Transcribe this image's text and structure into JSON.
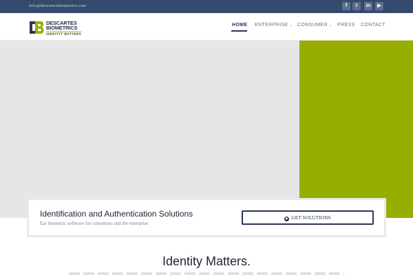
{
  "topbar": {
    "email": "info@descartesbiometrics.com",
    "social": [
      {
        "icon": "facebook-icon",
        "glyph": "f"
      },
      {
        "icon": "twitter-icon",
        "glyph": "t"
      },
      {
        "icon": "linkedin-icon",
        "glyph": "in"
      },
      {
        "icon": "youtube-icon",
        "glyph": "▶"
      }
    ]
  },
  "logo": {
    "line1": "DESCARTES",
    "line2": "BIOMETRICS",
    "tagline": "IDENTITY MATTERS"
  },
  "nav": [
    {
      "label": "HOME",
      "active": true
    },
    {
      "label": "ENTERPRISE",
      "caret": "⌄"
    },
    {
      "label": "CONSUMER",
      "caret": "⌄"
    },
    {
      "label": "PRESS"
    },
    {
      "label": "CONTACT"
    }
  ],
  "solutions": {
    "title": "Identification and Authentication Solutions",
    "subtitle": "Ear biometric software for consumers and the enterprise",
    "button_label": "GET SOLUTIONS"
  },
  "section": {
    "heading": "Identity Matters."
  },
  "colors": {
    "topbar": "#34496b",
    "accent_green": "#97ae00",
    "navy": "#2a3552"
  }
}
